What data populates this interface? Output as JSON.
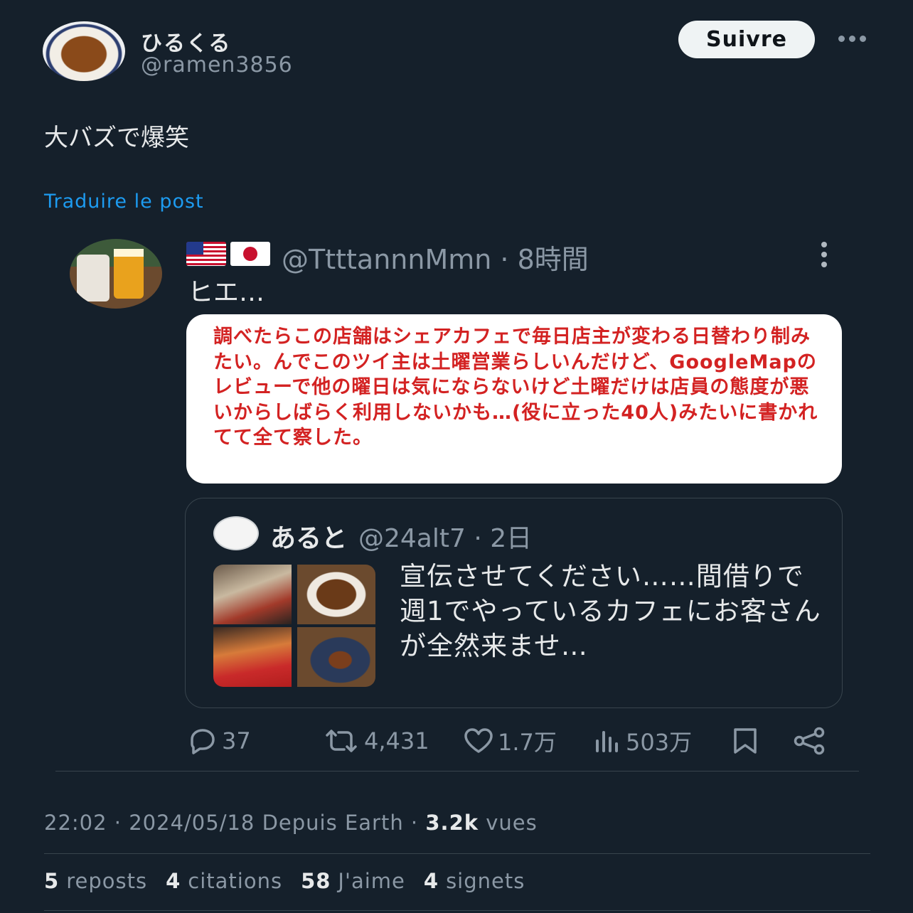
{
  "header": {
    "display_name": "ひるくる",
    "handle": "@ramen3856",
    "follow_label": "Suivre"
  },
  "post": {
    "text": "大バズで爆笑",
    "translate_label": "Traduire le post"
  },
  "embedded_post": {
    "handle_time": "@TtttannnMmn · 8時間",
    "text": "ヒエ…",
    "note": "調べたらこの店舗はシェアカフェで毎日店主が変わる日替わり制みたい。んでこのツイ主は土曜営業らしいんだけど、GoogleMapのレビューで他の曜日は気にならないけど土曜だけは店員の態度が悪いからしばらく利用しないかも…(役に立った40人)みたいに書かれてて全て察した。",
    "quoted": {
      "name": "あると",
      "handle_time": "@24alt7 · 2日",
      "text": "宣伝させてください……間借りで週1でやっているカフェにお客さんが全然来ませ…"
    },
    "actions": {
      "replies": "37",
      "reposts": "4,431",
      "likes": "1.7万",
      "views": "503万"
    }
  },
  "meta": {
    "time": "22:02 · 2024/05/18 Depuis Earth · ",
    "views_count": "3.2k",
    "views_label": " vues"
  },
  "stats": {
    "reposts_count": "5",
    "reposts_label": "reposts",
    "quotes_count": "4",
    "quotes_label": "citations",
    "likes_count": "58",
    "likes_label": "J'aime",
    "bookmarks_count": "4",
    "bookmarks_label": "signets"
  },
  "colors": {
    "background": "#15202b",
    "accent_link": "#1d9bf0",
    "note_text": "#d32222"
  }
}
